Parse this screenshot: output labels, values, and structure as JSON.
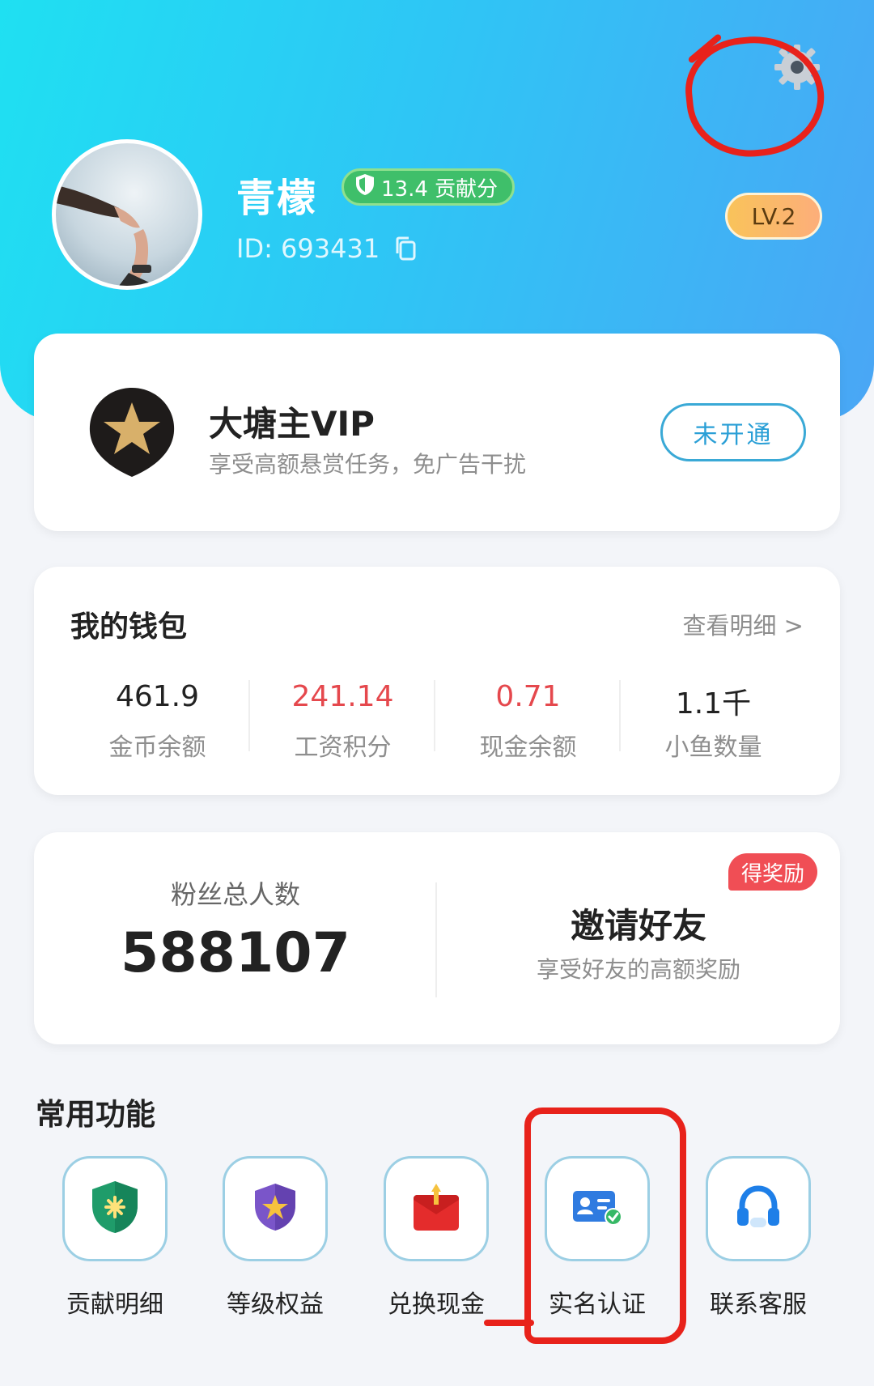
{
  "profile": {
    "username": "青檬",
    "contribution_badge": "13.4 贡献分",
    "user_id": "ID: 693431",
    "level": "LV.2"
  },
  "vip": {
    "title": "大塘主VIP",
    "subtitle": "享受高额悬赏任务，免广告干扰",
    "button": "未开通"
  },
  "wallet": {
    "title": "我的钱包",
    "details_link": "查看明细 >",
    "stats": [
      {
        "value": "461.9",
        "label": "金币余额",
        "color": "#222222"
      },
      {
        "value": "241.14",
        "label": "工资积分",
        "color": "#e5484d"
      },
      {
        "value": "0.71",
        "label": "现金余额",
        "color": "#e5484d"
      },
      {
        "value": "1.1千",
        "label": "小鱼数量",
        "color": "#222222"
      }
    ]
  },
  "fans": {
    "label": "粉丝总人数",
    "count": "588107"
  },
  "invite": {
    "title": "邀请好友",
    "subtitle": "享受好友的高额奖励",
    "badge": "得奖励"
  },
  "functions": {
    "title": "常用功能",
    "items": [
      {
        "label": "贡献明细",
        "icon": "shield-check-icon"
      },
      {
        "label": "等级权益",
        "icon": "shield-star-icon"
      },
      {
        "label": "兑换现金",
        "icon": "red-envelope-icon"
      },
      {
        "label": "实名认证",
        "icon": "id-card-icon"
      },
      {
        "label": "联系客服",
        "icon": "headset-icon"
      }
    ]
  },
  "colors": {
    "header_gradient_start": "#1fe0f2",
    "header_gradient_end": "#4aa6f5",
    "accent_red": "#e5484d",
    "annotation_red": "#e8221b",
    "badge_green": "#3fbf6a"
  }
}
